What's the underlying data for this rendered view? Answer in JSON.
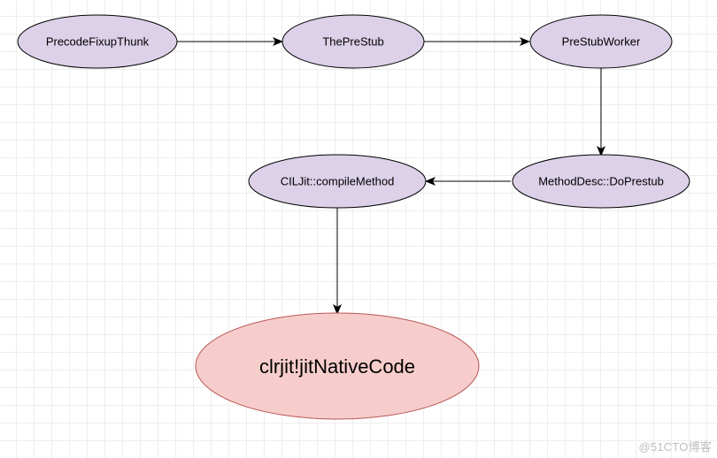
{
  "diagram": {
    "nodes": {
      "n1": {
        "label": "PrecodeFixupThunk",
        "shape": "ellipse",
        "color": "purple"
      },
      "n2": {
        "label": "ThePreStub",
        "shape": "ellipse",
        "color": "purple"
      },
      "n3": {
        "label": "PreStubWorker",
        "shape": "ellipse",
        "color": "purple"
      },
      "n4": {
        "label": "MethodDesc::DoPrestub",
        "shape": "ellipse",
        "color": "purple"
      },
      "n5": {
        "label": "CILJit::compileMethod",
        "shape": "ellipse",
        "color": "purple"
      },
      "n6": {
        "label": "clrjit!jitNativeCode",
        "shape": "ellipse",
        "color": "red"
      }
    },
    "edges": [
      {
        "from": "n1",
        "to": "n2"
      },
      {
        "from": "n2",
        "to": "n3"
      },
      {
        "from": "n3",
        "to": "n4"
      },
      {
        "from": "n4",
        "to": "n5"
      },
      {
        "from": "n5",
        "to": "n6"
      }
    ]
  },
  "watermark": "@51CTO博客"
}
